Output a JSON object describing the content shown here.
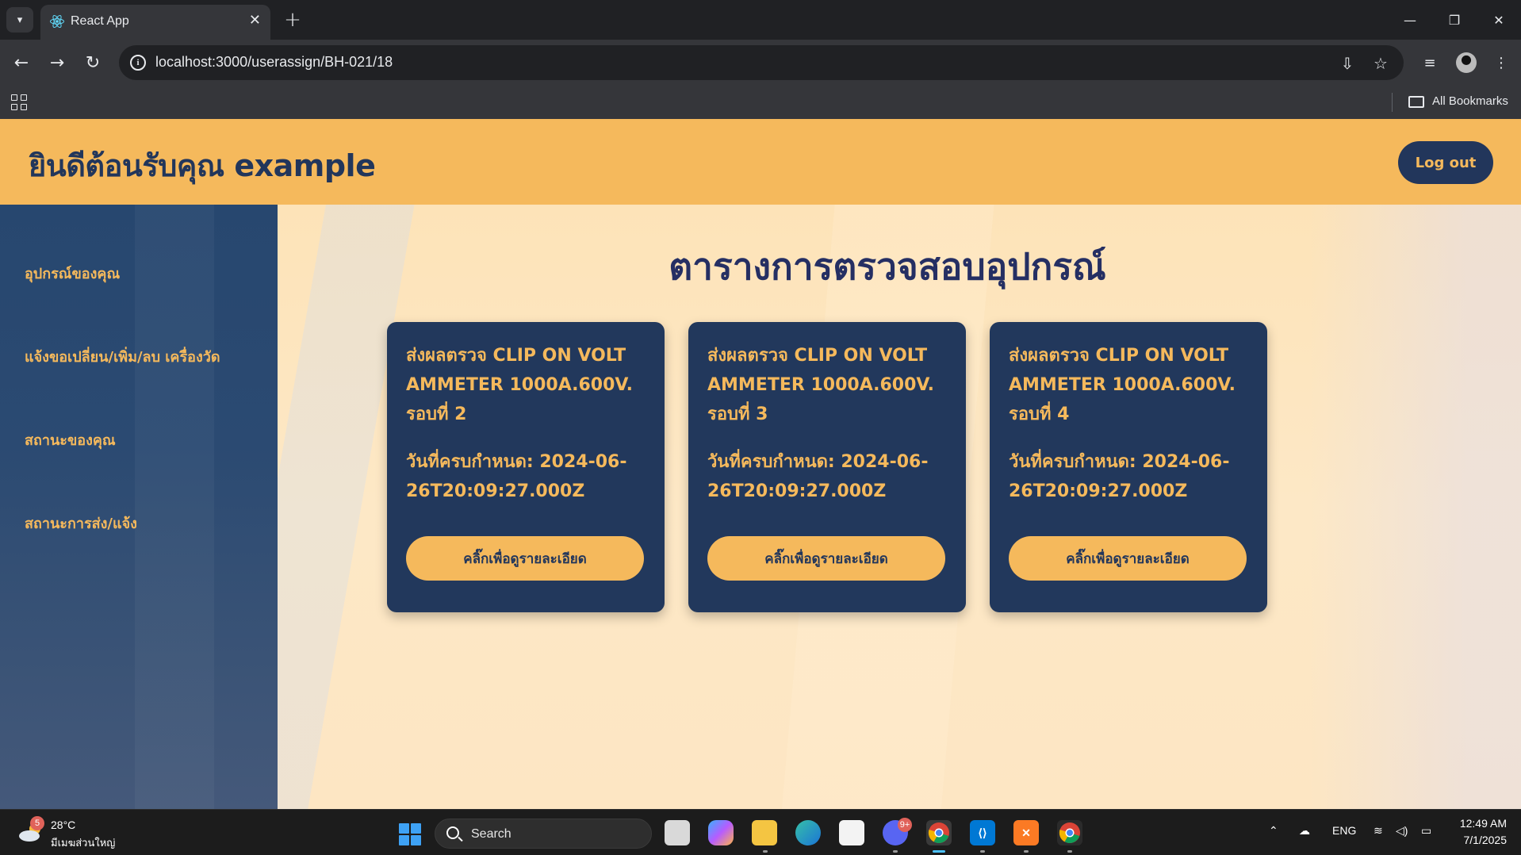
{
  "browser": {
    "tab_title": "React App",
    "url": "localhost:3000/userassign/BH-021/18",
    "bookmarks_label": "All Bookmarks"
  },
  "header": {
    "welcome": "ยินดีต้อนรับคุณ example",
    "logout_label": "Log out"
  },
  "sidebar": {
    "items": [
      {
        "label": "อุปกรณ์ของคุณ"
      },
      {
        "label": "แจ้งขอเปลี่ยน/เพิ่ม/ลบ เครื่องวัด"
      },
      {
        "label": "สถานะของคุณ"
      },
      {
        "label": "สถานะการส่ง/แจ้ง"
      }
    ]
  },
  "main": {
    "title": "ตารางการตรวจสอบอุปกรณ์",
    "cards": [
      {
        "title": "ส่งผลตรวจ CLIP ON VOLT AMMETER 1000A.600V. รอบที่ 2",
        "due": "วันที่ครบกำหนด: 2024-06-26T20:09:27.000Z",
        "button": "คลิ๊กเพื่อดูรายละเอียด"
      },
      {
        "title": "ส่งผลตรวจ CLIP ON VOLT AMMETER 1000A.600V. รอบที่ 3",
        "due": "วันที่ครบกำหนด: 2024-06-26T20:09:27.000Z",
        "button": "คลิ๊กเพื่อดูรายละเอียด"
      },
      {
        "title": "ส่งผลตรวจ CLIP ON VOLT AMMETER 1000A.600V. รอบที่ 4",
        "due": "วันที่ครบกำหนด: 2024-06-26T20:09:27.000Z",
        "button": "คลิ๊กเพื่อดูรายละเอียด"
      }
    ]
  },
  "taskbar": {
    "weather_temp": "28°C",
    "weather_desc": "มีเมฆส่วนใหญ่",
    "weather_badge": "5",
    "search_label": "Search",
    "language": "ENG",
    "time": "12:49 AM",
    "date": "7/1/2025",
    "discord_badge": "9+"
  },
  "colors": {
    "header_bg": "#f5b95c",
    "navy": "#22365b",
    "card_bg": "#22385c",
    "accent": "#f5b95c",
    "title_text": "#252f63"
  }
}
